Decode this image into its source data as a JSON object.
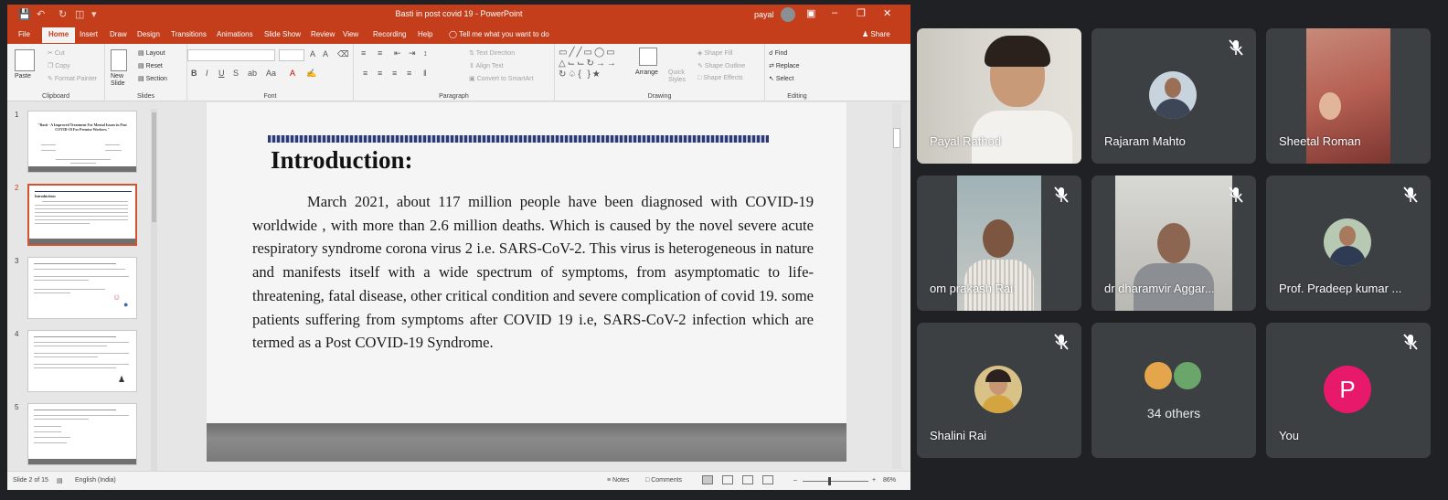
{
  "powerpoint": {
    "doc_title": "Basti in post covid 19  -  PowerPoint",
    "user_name": "payal",
    "tabs": [
      "File",
      "Home",
      "Insert",
      "Draw",
      "Design",
      "Transitions",
      "Animations",
      "Slide Show",
      "Review",
      "View",
      "Recording",
      "Help"
    ],
    "active_tab": "Home",
    "tell_me": "Tell me what you want to do",
    "share": "Share",
    "ribbon": {
      "clipboard": {
        "label": "Clipboard",
        "paste": "Paste",
        "cut": "Cut",
        "copy": "Copy",
        "format_painter": "Format Painter"
      },
      "slides": {
        "label": "Slides",
        "new_slide": "New Slide",
        "layout": "Layout",
        "reset": "Reset",
        "section": "Section"
      },
      "font": {
        "label": "Font"
      },
      "paragraph": {
        "label": "Paragraph",
        "text_direction": "Text Direction",
        "align_text": "Align Text",
        "convert_smartart": "Convert to SmartArt"
      },
      "drawing": {
        "label": "Drawing",
        "arrange": "Arrange",
        "quick_styles": "Quick Styles",
        "shape_fill": "Shape Fill",
        "shape_outline": "Shape Outline",
        "shape_effects": "Shape Effects"
      },
      "editing": {
        "label": "Editing",
        "find": "Find",
        "replace": "Replace",
        "select": "Select"
      }
    },
    "thumbnails": [
      {
        "num": "1",
        "title": "\"Basti - A Improved Treatment For Mental Issues in Post COVID-19 For Premise Workers.\""
      },
      {
        "num": "2",
        "title": "Introduction:"
      },
      {
        "num": "3",
        "title": ""
      },
      {
        "num": "4",
        "title": ""
      },
      {
        "num": "5",
        "title": ""
      }
    ],
    "slide": {
      "heading": "Introduction:",
      "body": "March 2021, about 117 million people have been diagnosed with COVID-19 worldwide , with more than 2.6 million deaths. Which is caused by the novel severe acute respiratory syndrome corona virus 2 i.e. SARS-CoV-2. This virus is heterogeneous in nature  and manifests itself with a wide spectrum of symptoms, from asymptomatic to life-threatening, fatal disease, other critical condition and severe complication of covid 19. some patients suffering from symptoms after COVID 19 i.e, SARS-CoV-2 infection which are termed as a Post COVID-19 Syndrome."
    },
    "status": {
      "slide_of": "Slide 2 of 15",
      "language": "English (India)",
      "notes": "Notes",
      "comments": "Comments",
      "zoom": "86%"
    }
  },
  "meet": {
    "participants": [
      {
        "name": "Payal Rathod",
        "muted": false,
        "kind": "video"
      },
      {
        "name": "Rajaram Mahto",
        "muted": true,
        "kind": "avatar"
      },
      {
        "name": "Sheetal Roman",
        "muted": false,
        "kind": "video"
      },
      {
        "name": "om prakash Rai",
        "muted": true,
        "kind": "video"
      },
      {
        "name": "dr dharamvir Aggar...",
        "muted": true,
        "kind": "video"
      },
      {
        "name": "Prof. Pradeep kumar ...",
        "muted": true,
        "kind": "avatar"
      },
      {
        "name": "Shalini Rai",
        "muted": true,
        "kind": "avatar"
      },
      {
        "name": "34 others",
        "muted": true,
        "kind": "group"
      },
      {
        "name": "You",
        "muted": true,
        "kind": "letter",
        "letter": "P"
      }
    ],
    "colors": {
      "tile_bg": "#3c4043",
      "page_bg": "#202124",
      "you_avatar": "#e8196a"
    }
  }
}
